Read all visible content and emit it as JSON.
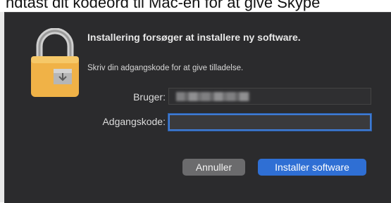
{
  "background": {
    "text": "ndtast dit kodeord til Mac-en for at give Skype"
  },
  "dialog": {
    "title": "Installering forsøger at installere ny software.",
    "subtitle": "Skriv din adgangskode for at give tilladelse.",
    "icon": "lock-icon",
    "fields": {
      "user_label": "Bruger:",
      "user_value": "",
      "password_label": "Adgangskode:",
      "password_value": ""
    },
    "buttons": {
      "cancel": "Annuller",
      "confirm": "Installer software"
    },
    "colors": {
      "dialog_bg": "#2b2b2d",
      "accent": "#2f6fd4",
      "lock_body": "#f0b247",
      "lock_shackle": "#c9c9c9"
    }
  }
}
